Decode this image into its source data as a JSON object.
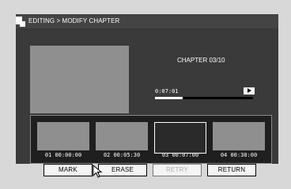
{
  "title": "EDITING > MODIFY CHAPTER",
  "preview": {
    "chapter_label": "CHAPTER 03/10",
    "timecode": "0:07:01",
    "progress_percent": 28,
    "play_icon": "play-icon"
  },
  "chapters": [
    {
      "caption": "01 00:00:00",
      "selected": false
    },
    {
      "caption": "02 00:05:30",
      "selected": false
    },
    {
      "caption": "03 00:07:00",
      "selected": true
    },
    {
      "caption": "04 00:30:00",
      "selected": false
    }
  ],
  "buttons": {
    "mark": "MARK",
    "erase": "ERASE",
    "retry": "RETRY",
    "return": "RETURN"
  },
  "colors": {
    "panel": "#3a3a3a",
    "titlebar": "#444444",
    "thumbnail": "#8f8f8f",
    "background": "#d8d8d8"
  },
  "icons": {
    "title": "chapter-icon",
    "cursor": "pointer-cursor-icon"
  }
}
